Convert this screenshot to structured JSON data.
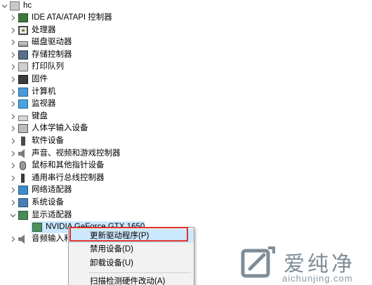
{
  "tree": {
    "root": {
      "label": "hc"
    },
    "categories": [
      {
        "label": "IDE ATA/ATAPI 控制器",
        "icon": "ide-controller-icon",
        "expanded": false
      },
      {
        "label": "处理器",
        "icon": "processor-icon",
        "expanded": false
      },
      {
        "label": "磁盘驱动器",
        "icon": "disk-drive-icon",
        "expanded": false
      },
      {
        "label": "存储控制器",
        "icon": "storage-controller-icon",
        "expanded": false
      },
      {
        "label": "打印队列",
        "icon": "printer-icon",
        "expanded": false
      },
      {
        "label": "固件",
        "icon": "firmware-icon",
        "expanded": false
      },
      {
        "label": "计算机",
        "icon": "computer-icon",
        "expanded": false
      },
      {
        "label": "监视器",
        "icon": "monitor-icon",
        "expanded": false
      },
      {
        "label": "键盘",
        "icon": "keyboard-icon",
        "expanded": false
      },
      {
        "label": "人体学输入设备",
        "icon": "hid-icon",
        "expanded": false
      },
      {
        "label": "软件设备",
        "icon": "software-device-icon",
        "expanded": false
      },
      {
        "label": "声音、视频和游戏控制器",
        "icon": "audio-icon",
        "expanded": false
      },
      {
        "label": "鼠标和其他指针设备",
        "icon": "mouse-icon",
        "expanded": false
      },
      {
        "label": "通用串行总线控制器",
        "icon": "usb-icon",
        "expanded": false
      },
      {
        "label": "网络适配器",
        "icon": "network-adapter-icon",
        "expanded": false
      },
      {
        "label": "系统设备",
        "icon": "system-device-icon",
        "expanded": false
      },
      {
        "label": "显示适配器",
        "icon": "display-adapter-icon",
        "expanded": true
      }
    ],
    "selected_device": {
      "label": "NVIDIA GeForce GTX 1650",
      "icon": "gpu-icon"
    },
    "partial_category": {
      "label": "音频输入和",
      "icon": "audio-input-icon"
    }
  },
  "context_menu": {
    "items": [
      {
        "label": "更新驱动程序(P)",
        "highlighted": true
      },
      {
        "label": "禁用设备(D)"
      },
      {
        "label": "卸载设备(U)"
      },
      {
        "label": "扫描检测硬件改动(A)"
      }
    ]
  },
  "watermark": {
    "text": "爱纯净",
    "url": "aichunjing.com"
  },
  "colors": {
    "selection": "#cce8ff",
    "highlight_box": "#e0302a",
    "watermark": "#7f8d98"
  }
}
